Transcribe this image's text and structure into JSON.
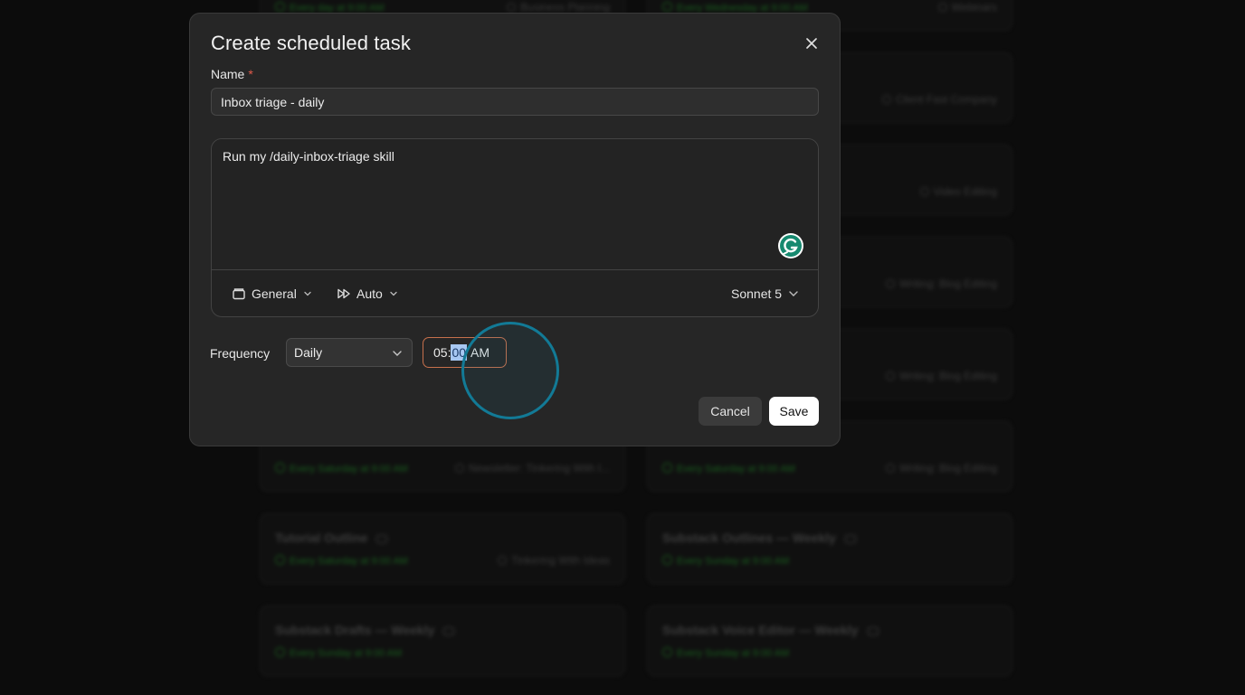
{
  "background_cards": [
    {
      "title": "",
      "schedule": "Every day at 9:00 AM",
      "project": "Business Planning"
    },
    {
      "title": "",
      "schedule": "Every Wednesday at 9:00 AM",
      "project": "Webinars"
    },
    {
      "title": "",
      "schedule": "",
      "project": "Client Fast Company"
    },
    {
      "title": "",
      "schedule": "",
      "project": "Video Editing"
    },
    {
      "title": "",
      "schedule": "",
      "project": "Writing: Blog Editing"
    },
    {
      "title": "",
      "schedule": "",
      "project": "Writing: Blog Editing"
    },
    {
      "title": "",
      "schedule": "Every Saturday at 9:00 AM",
      "project": "Newsletter: Tinkering With I..."
    },
    {
      "title": "",
      "schedule": "Every Saturday at 9:00 AM",
      "project": "Writing: Blog Editing"
    },
    {
      "title": "Tutorial Outline",
      "schedule": "Every Saturday at 9:00 AM",
      "project": "Tinkering With Ideas"
    },
    {
      "title": "Substack Outlines — Weekly",
      "schedule": "Every Sunday at 9:00 AM",
      "project": ""
    },
    {
      "title": "Substack Drafts — Weekly",
      "schedule": "Every Sunday at 9:00 AM",
      "project": ""
    },
    {
      "title": "Substack Voice Editor — Weekly",
      "schedule": "Every Sunday at 9:00 AM",
      "project": ""
    }
  ],
  "dialog": {
    "title": "Create scheduled task",
    "close_icon": "close-icon",
    "name_label": "Name",
    "required_mark": "*",
    "name_value": "Inbox triage - daily",
    "prompt_value": "Run my /daily-inbox-triage skill",
    "toolbar": {
      "project_label": "General",
      "mode_label": "Auto",
      "model_label": "Sonnet 5"
    },
    "frequency_label": "Frequency",
    "frequency_value": "Daily",
    "time": {
      "hours": "05",
      "separator": ":",
      "minutes": "00",
      "period": "AM"
    },
    "cancel_label": "Cancel",
    "save_label": "Save"
  },
  "colors": {
    "dialog_bg": "#262626",
    "accent_time_border": "#c7704c",
    "click_ring": "#127a96",
    "save_bg": "#ffffff",
    "required": "#e05a4a"
  }
}
